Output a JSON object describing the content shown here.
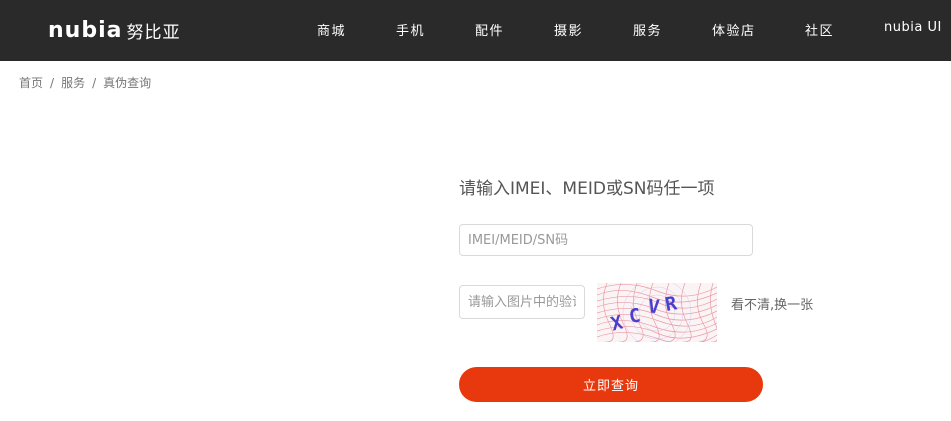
{
  "header": {
    "logo_text": "nubia",
    "logo_cn": "努比亚",
    "nav": [
      {
        "label": "商城"
      },
      {
        "label": "手机"
      },
      {
        "label": "配件"
      },
      {
        "label": "摄影"
      },
      {
        "label": "服务"
      },
      {
        "label": "体验店"
      },
      {
        "label": "社区"
      },
      {
        "label": "nubia UI"
      }
    ]
  },
  "breadcrumb": {
    "items": [
      "首页",
      "服务",
      "真伪查询"
    ],
    "separator": "/"
  },
  "form": {
    "title": "请输入IMEI、MEID或SN码任一项",
    "imei_placeholder": "IMEI/MEID/SN码",
    "imei_value": "",
    "captcha_placeholder": "请输入图片中的验证码",
    "captcha_value": "",
    "captcha_text": "XCVR",
    "refresh_label": "看不清,换一张",
    "submit_label": "立即查询"
  },
  "colors": {
    "header_bg": "#2a2a2a",
    "accent": "#e8380d",
    "captcha_text": "#4a3fd1",
    "captcha_noise": "#e88a9a"
  }
}
